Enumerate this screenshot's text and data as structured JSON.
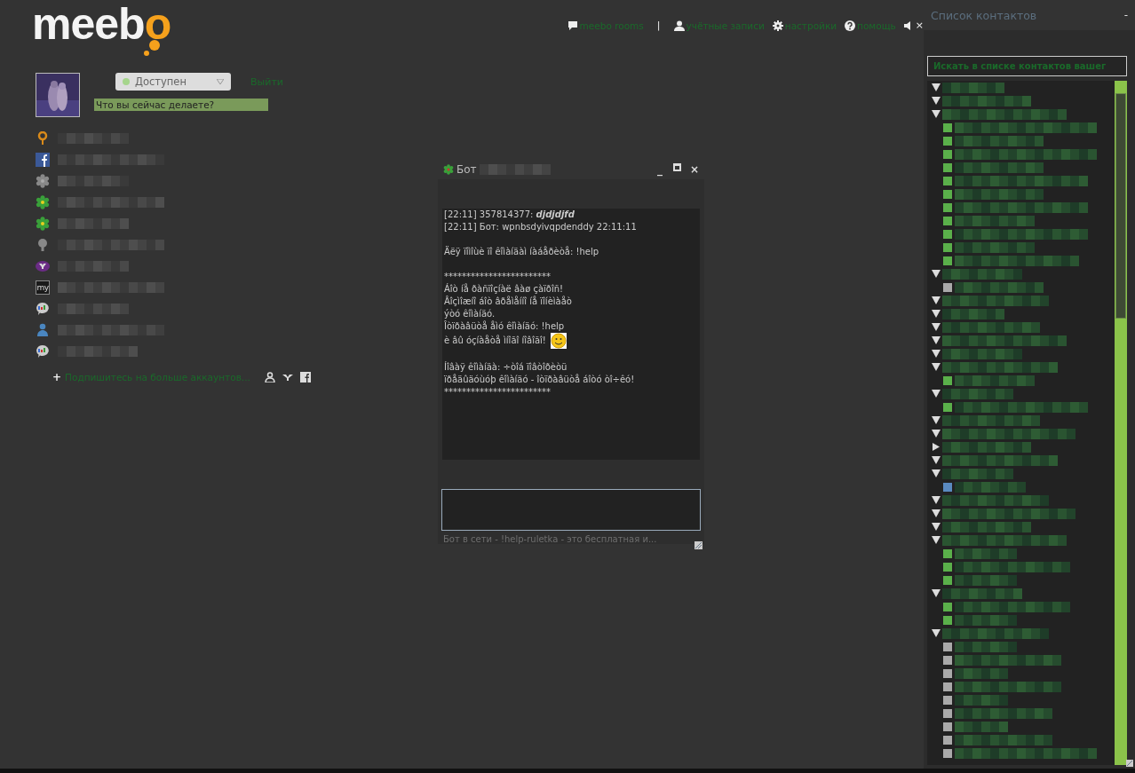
{
  "logo": "meebo",
  "nav": [
    {
      "kind": "rooms",
      "label": "meebo rooms"
    },
    {
      "kind": "separator",
      "label": "|"
    },
    {
      "kind": "accounts",
      "label": "учётные записи"
    },
    {
      "kind": "settings",
      "label": "настройки"
    },
    {
      "kind": "help",
      "label": "помощь"
    }
  ],
  "sound": {
    "muted": true,
    "mark": "×"
  },
  "profile": {
    "status": "Доступен",
    "logout": "Выйти",
    "mood_placeholder": "Что вы сейчас делаете?"
  },
  "accounts": [
    {
      "kind": "meebo"
    },
    {
      "kind": "facebook"
    },
    {
      "kind": "icq-offline"
    },
    {
      "kind": "icq"
    },
    {
      "kind": "icq"
    },
    {
      "kind": "bulb"
    },
    {
      "kind": "yahoo"
    },
    {
      "kind": "myspace",
      "icon_text": "my"
    },
    {
      "kind": "gtalk"
    },
    {
      "kind": "msn"
    },
    {
      "kind": "gtalk"
    }
  ],
  "subscribe": {
    "plus": "+",
    "label": "Подпишитесь на больше аккаунтов..."
  },
  "chat": {
    "title": "Бот",
    "minimize": "_",
    "close": "×",
    "lines": [
      {
        "kind": "rich",
        "text": "[22:11] 357814377: **djdjdjfd**"
      },
      {
        "kind": "text",
        "text": "[22:11] Бот: wpnbsdyivqpdenddy 22:11:11"
      },
      {
        "kind": "blank"
      },
      {
        "kind": "text",
        "text": "Äëÿ ïîìîùè ïî êîìàíäàì íàáåðèòå: !help"
      },
      {
        "kind": "blank"
      },
      {
        "kind": "text",
        "text": "************************"
      },
      {
        "kind": "text",
        "text": "Áîò íå ðàñïîçíàë âàø çàïðîñ!"
      },
      {
        "kind": "text",
        "text": "Âîçìîæíî áîò âðåìåííî íå ïîíèìàåò"
      },
      {
        "kind": "text",
        "text": "ýòó êîìàíäó."
      },
      {
        "kind": "text",
        "text": "Îòïðàâüòå åìó êîìàíäó: !help"
      },
      {
        "kind": "smiley",
        "text": "è âû óçíàåòå ìíîãî íîâîãî!"
      },
      {
        "kind": "blank"
      },
      {
        "kind": "text",
        "text": "Íîâàÿ êîìàíäà: ÷òîá ïîâòîðèòü"
      },
      {
        "kind": "text",
        "text": "ïðåäûäóùóþ êîìàíäó - îòïðàâüòå áîòó òî÷êó!"
      },
      {
        "kind": "text",
        "text": "************************"
      }
    ],
    "status": "Бот в сети - !help-ruletka - это бесплатная и..."
  },
  "contacts": {
    "title": "Список контактов",
    "minimize": "-",
    "search_placeholder": "Искать в списке контактов вашег",
    "groups": [
      {
        "expanded": true
      },
      {
        "expanded": true
      },
      {
        "expanded": true,
        "children": [
          {
            "kind": "online"
          },
          {
            "kind": "online"
          },
          {
            "kind": "online"
          },
          {
            "kind": "online"
          },
          {
            "kind": "online"
          },
          {
            "kind": "online"
          },
          {
            "kind": "online"
          },
          {
            "kind": "online"
          },
          {
            "kind": "online"
          },
          {
            "kind": "online"
          },
          {
            "kind": "online"
          }
        ]
      },
      {
        "expanded": true,
        "children": [
          {
            "kind": "idle"
          }
        ]
      },
      {
        "expanded": true
      },
      {
        "expanded": true
      },
      {
        "expanded": true
      },
      {
        "expanded": true
      },
      {
        "expanded": true
      },
      {
        "expanded": true,
        "children": [
          {
            "kind": "online"
          }
        ]
      },
      {
        "expanded": true,
        "children": [
          {
            "kind": "online"
          }
        ]
      },
      {
        "expanded": true
      },
      {
        "expanded": true
      },
      {
        "expanded": false
      },
      {
        "expanded": true
      },
      {
        "expanded": true,
        "children": [
          {
            "kind": "mobile"
          }
        ]
      },
      {
        "expanded": true
      },
      {
        "expanded": true
      },
      {
        "expanded": true
      },
      {
        "expanded": true,
        "children": [
          {
            "kind": "online"
          },
          {
            "kind": "online"
          },
          {
            "kind": "online"
          }
        ]
      },
      {
        "expanded": true,
        "children": [
          {
            "kind": "online"
          },
          {
            "kind": "online"
          }
        ]
      },
      {
        "expanded": true,
        "children": [
          {
            "kind": "idle"
          },
          {
            "kind": "idle"
          },
          {
            "kind": "idle"
          },
          {
            "kind": "idle"
          },
          {
            "kind": "idle"
          },
          {
            "kind": "idle"
          },
          {
            "kind": "idle"
          },
          {
            "kind": "idle"
          },
          {
            "kind": "idle"
          }
        ]
      }
    ]
  }
}
